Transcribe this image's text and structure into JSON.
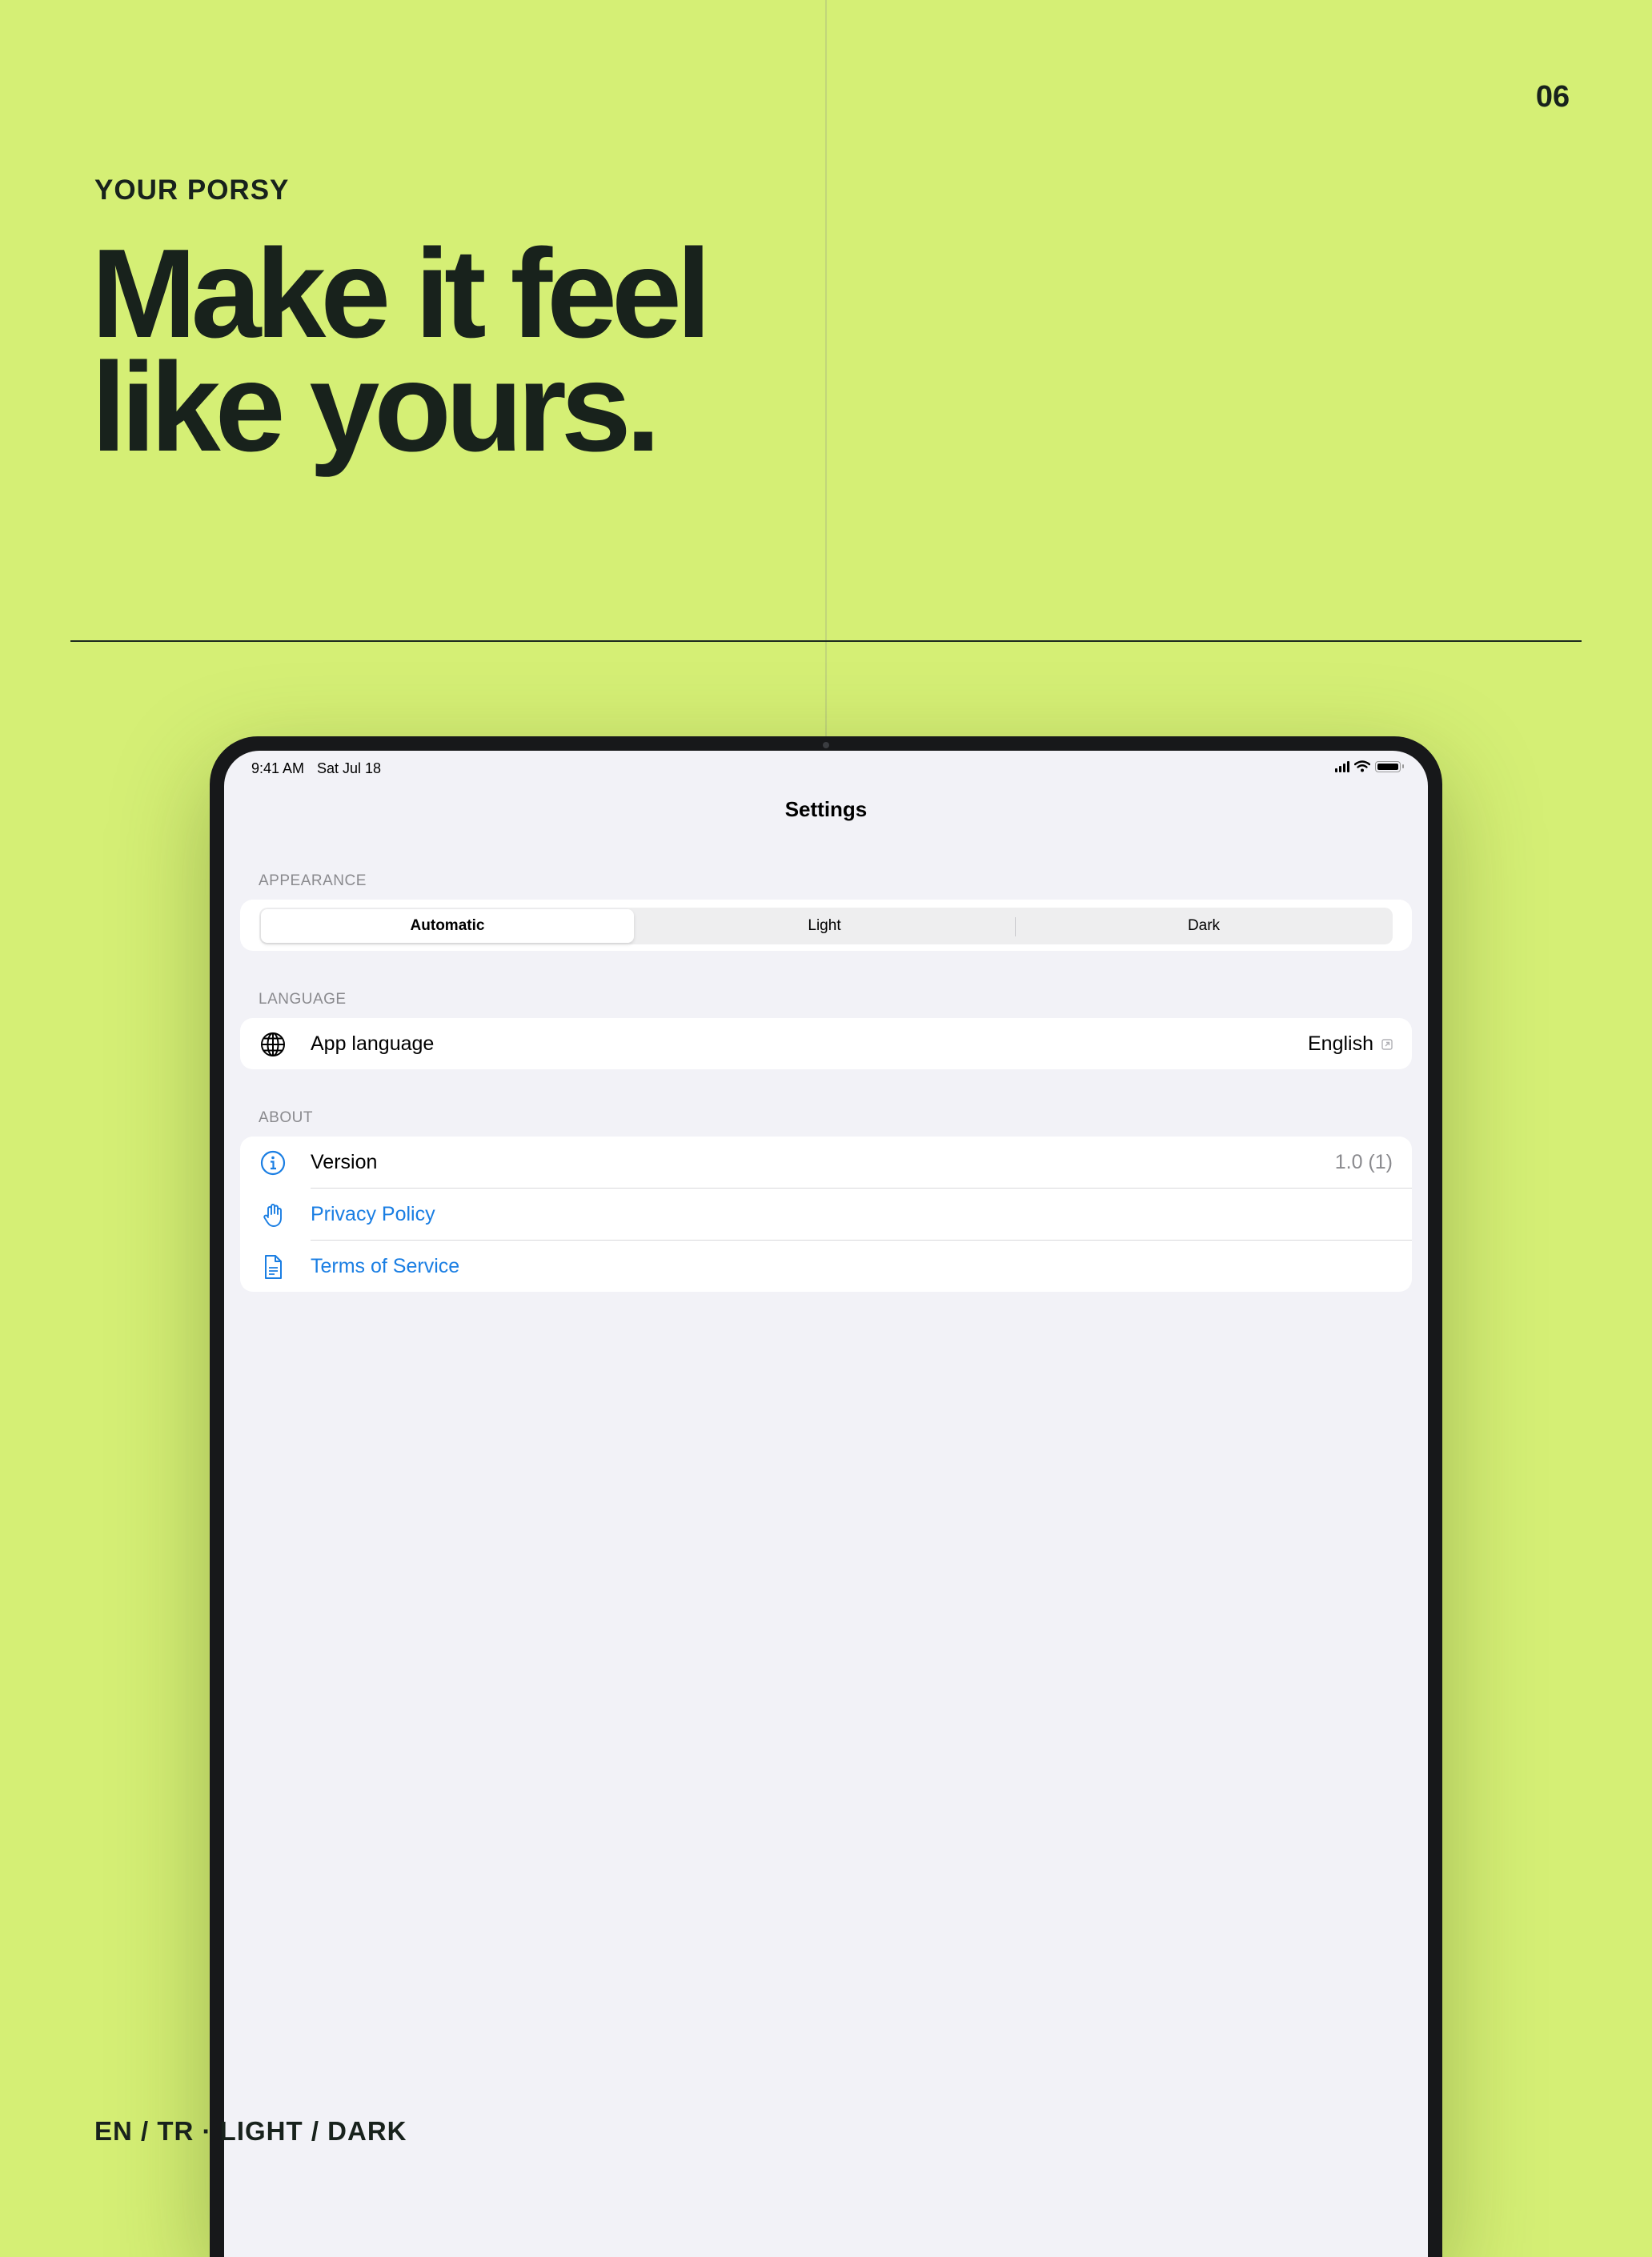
{
  "page": {
    "number": "06",
    "eyebrow": "YOUR PORSY",
    "headline_line1": "Make it feel",
    "headline_line2": "like yours.",
    "footer_caption": "EN / TR · LIGHT / DARK"
  },
  "colors": {
    "background": "#d5ef75",
    "ink": "#18221c",
    "device_frame": "#17181a",
    "screen_bg": "#f2f2f7",
    "link": "#1a7ee3",
    "secondary_text": "#8a8a8e"
  },
  "status_bar": {
    "time": "9:41 AM",
    "date": "Sat Jul 18",
    "icons": [
      "cellular-signal-icon",
      "wifi-icon",
      "battery-icon"
    ]
  },
  "settings": {
    "title": "Settings",
    "appearance": {
      "header": "APPEARANCE",
      "options": [
        "Automatic",
        "Light",
        "Dark"
      ],
      "selected": "Automatic"
    },
    "language": {
      "header": "LANGUAGE",
      "label": "App language",
      "value": "English",
      "icon": "globe-icon",
      "value_icon": "external-link-icon"
    },
    "about": {
      "header": "ABOUT",
      "items": [
        {
          "label": "Version",
          "value": "1.0 (1)",
          "icon": "info-circle-icon"
        },
        {
          "label": "Privacy Policy",
          "icon": "hand-raised-icon"
        },
        {
          "label": "Terms of Service",
          "icon": "document-icon"
        }
      ]
    }
  }
}
